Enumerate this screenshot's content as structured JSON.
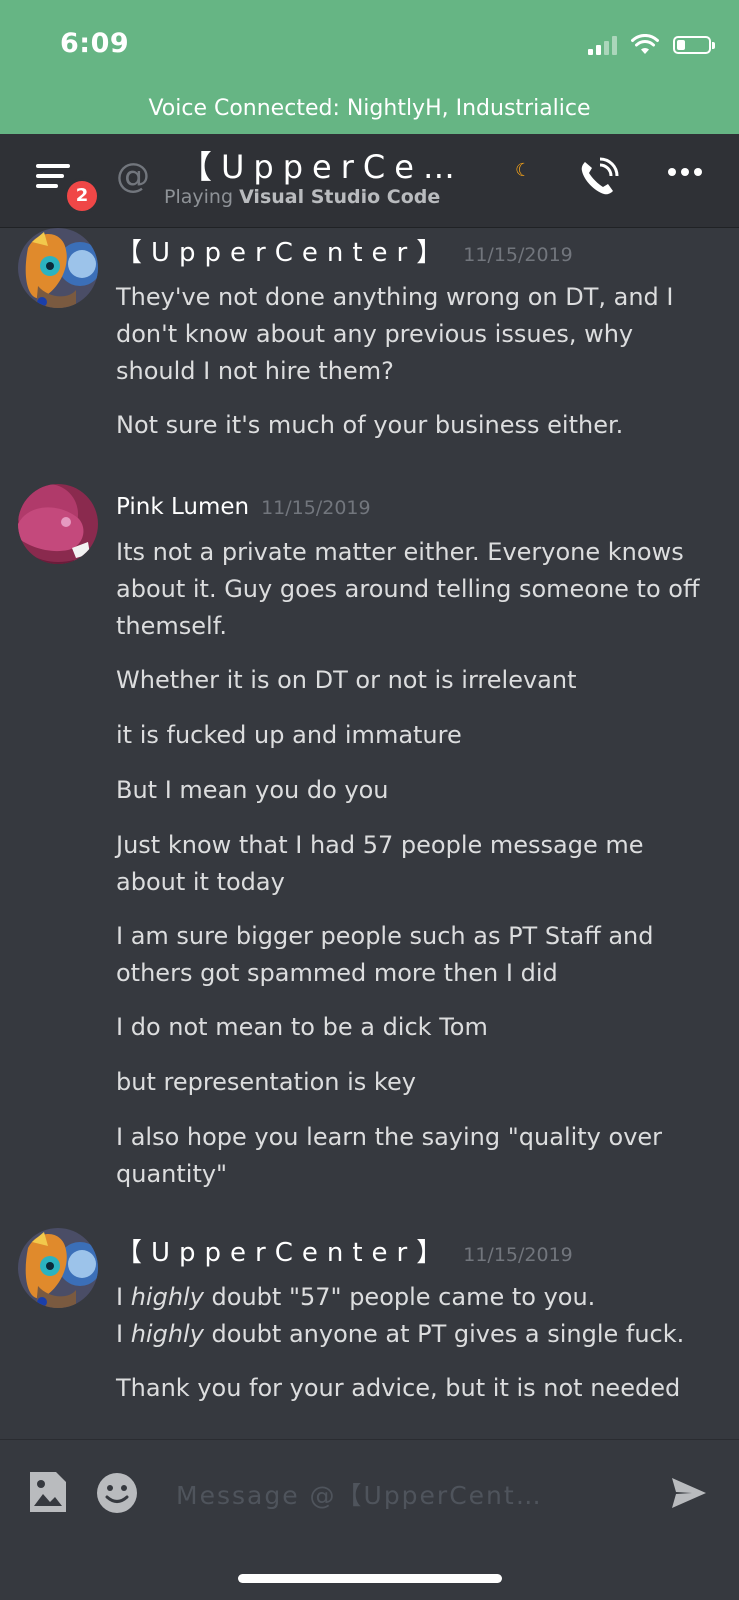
{
  "status_bar": {
    "time": "6:09",
    "battery_level": 0.2
  },
  "voice_banner": {
    "text": "Voice Connected: NightlyH, Industrialice",
    "color": "#66b584"
  },
  "header": {
    "badge_count": "2",
    "title": "【UpperCe…",
    "playing_prefix": "Playing",
    "playing_app": "Visual Studio Code",
    "status": "idle-moon-icon"
  },
  "messages": [
    {
      "author": "【UpperCenter】",
      "timestamp": "11/15/2019",
      "lines": [
        "They've not done anything wrong on DT, and I don't know about any previous issues, why should I not hire them?",
        "Not sure it's much of your business either."
      ]
    },
    {
      "author": "Pink Lumen",
      "timestamp": "11/15/2019",
      "lines": [
        "Its not a private matter either. Everyone knows about it. Guy goes around telling someone to off themself.",
        "Whether it is on DT or not is irrelevant",
        "it is fucked up and immature",
        "But I mean you do you",
        "Just know that I had 57 people message me about it today",
        "I am sure bigger people such as PT Staff and others got spammed more then I did",
        "I do not mean to be a dick Tom",
        "but representation is key",
        "I also hope you learn the saying \"quality over quantity\""
      ]
    },
    {
      "author": "【UpperCenter】",
      "timestamp": "11/15/2019",
      "lines": [
        {
          "pre": "I ",
          "em": "highly",
          "post": " doubt \"57\" people came  to you."
        },
        {
          "pre": "I ",
          "em": "highly",
          "post": " doubt anyone at PT gives a single fuck."
        },
        "Thank you for your advice, but it is not needed"
      ]
    }
  ],
  "composer": {
    "placeholder": "Message @【UpperCent…"
  },
  "colors": {
    "background": "#36393f",
    "header": "#2f3136",
    "badge": "#f04747"
  }
}
